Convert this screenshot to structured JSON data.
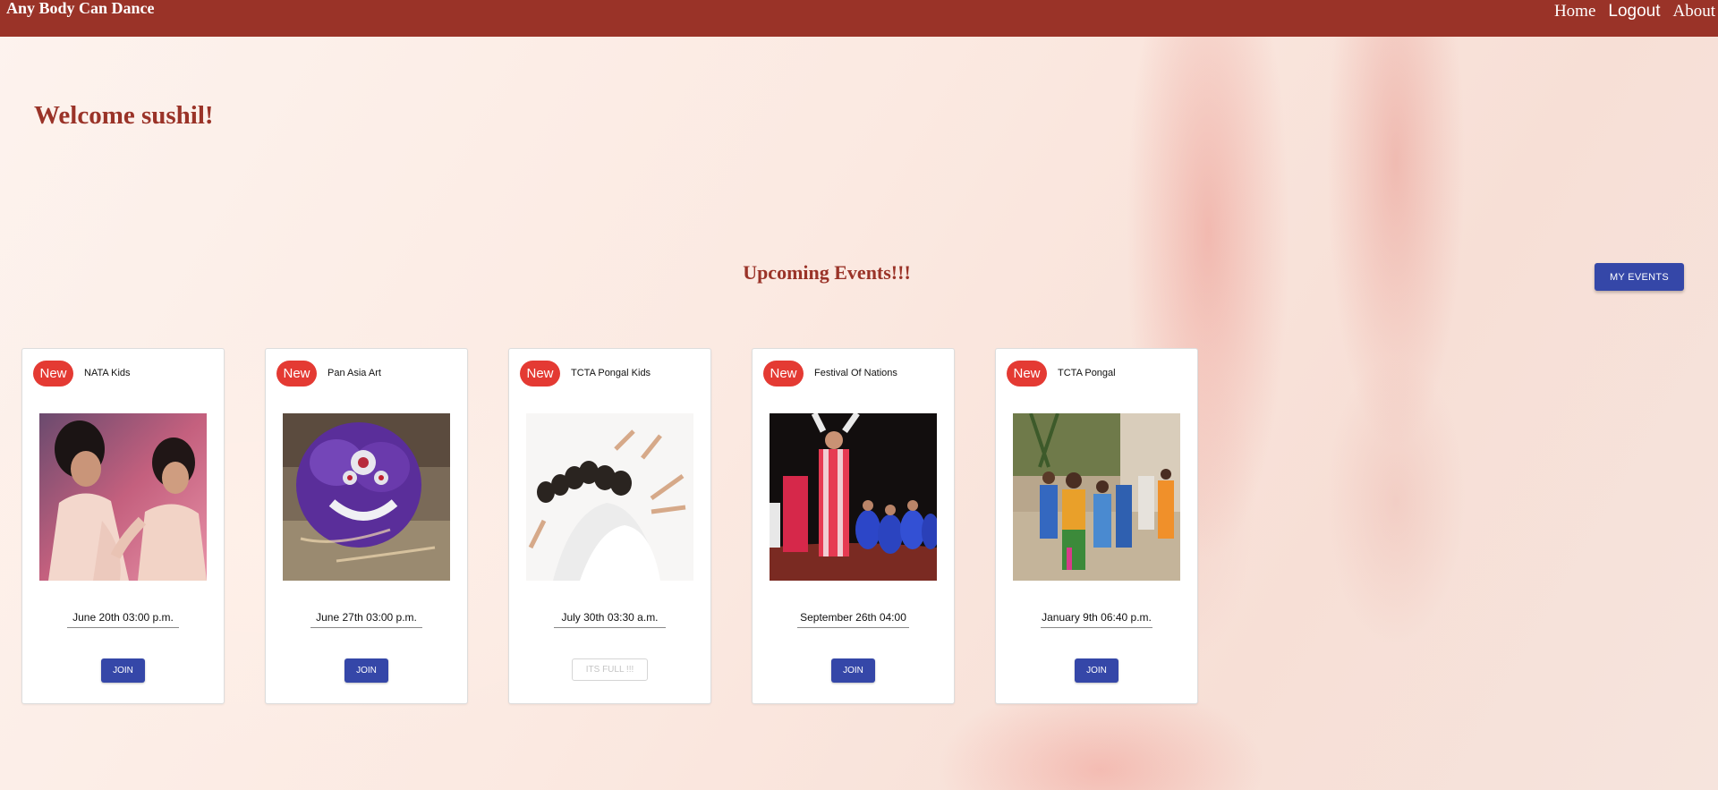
{
  "topbar": {
    "brand": "Any Body Can Dance",
    "nav": {
      "home": "Home",
      "logout": "Logout",
      "about": "About"
    },
    "color": "#9a3328"
  },
  "welcome": "Welcome sushil!",
  "upcoming_heading": "Upcoming Events!!!",
  "my_events_label": "MY EVENTS",
  "badge_label": "New",
  "events": [
    {
      "title": "NATA Kids",
      "date": "June 20th 03:00 p.m.",
      "action": "JOIN",
      "image": "two-girls-dancing-photo"
    },
    {
      "title": "Pan Asia Art",
      "date": "June 27th 03:00 p.m.",
      "action": "JOIN",
      "image": "lion-dance-costume-photo"
    },
    {
      "title": "TCTA Pongal Kids",
      "date": "July 30th 03:30 a.m.",
      "action": "ITS FULL !!!",
      "image": "group-dance-pose-photo"
    },
    {
      "title": "Festival Of Nations",
      "date": "September 26th 04:00",
      "action": "JOIN",
      "image": "stage-dance-troupe-photo"
    },
    {
      "title": "TCTA Pongal",
      "date": "January 9th 06:40 p.m.",
      "action": "JOIN",
      "image": "kids-pongal-dance-photo"
    }
  ],
  "colors": {
    "accent": "#3547a8",
    "badge": "#e43a33",
    "heading": "#9a3328"
  }
}
